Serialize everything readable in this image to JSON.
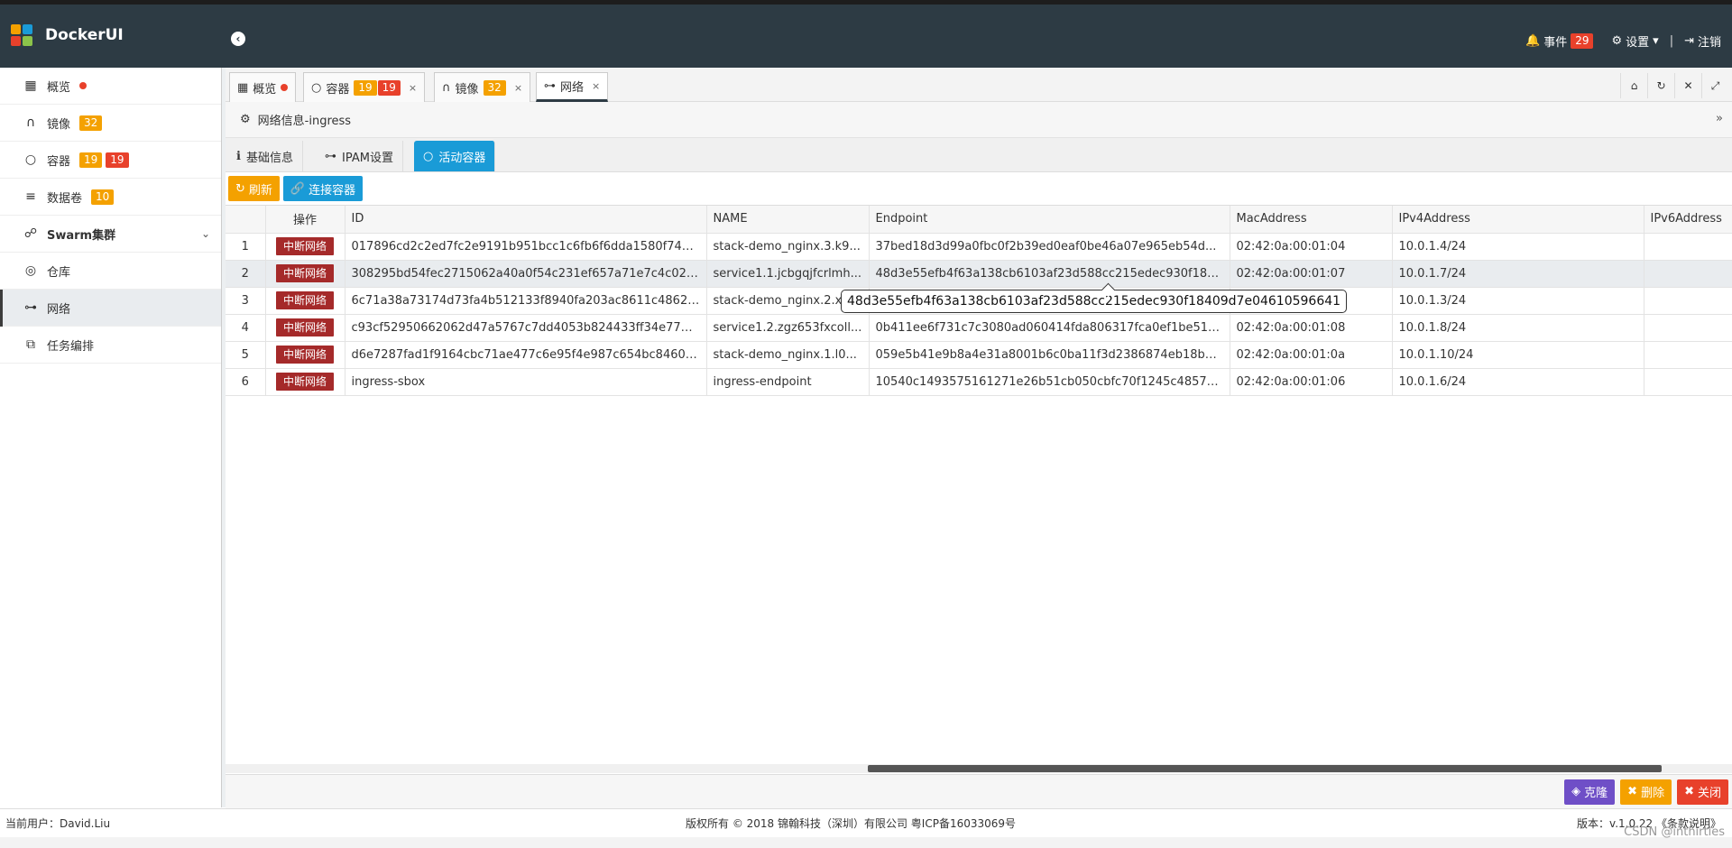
{
  "header": {
    "brand": "DockerUI",
    "events_label": "事件",
    "events_count": "29",
    "settings_label": "设置",
    "logout_label": "注销"
  },
  "sidebar": {
    "items": [
      {
        "label": "概览",
        "icon": "windows-icon"
      },
      {
        "label": "镜像",
        "icon": "headphones-icon",
        "badge": "32"
      },
      {
        "label": "容器",
        "icon": "ring-icon",
        "badge1": "19",
        "badge2": "19"
      },
      {
        "label": "数据卷",
        "icon": "database-icon",
        "badge": "10"
      },
      {
        "label": "Swarm集群",
        "icon": "sitemap-icon"
      },
      {
        "label": "仓库",
        "icon": "podcast-icon"
      },
      {
        "label": "网络",
        "icon": "usb-icon"
      },
      {
        "label": "任务编排",
        "icon": "puzzle-icon"
      }
    ]
  },
  "tabs": {
    "overview": "概览",
    "containers": "容器",
    "containers_b1": "19",
    "containers_b2": "19",
    "images": "镜像",
    "images_b": "32",
    "network": "网络",
    "close": "×"
  },
  "panel": {
    "title": "网络信息-ingress"
  },
  "subtabs": {
    "basic": "基础信息",
    "ipam": "IPAM设置",
    "active": "活动容器"
  },
  "toolbar": {
    "refresh": "刷新",
    "connect": "连接容器"
  },
  "table": {
    "headers": [
      "操作",
      "ID",
      "NAME",
      "Endpoint",
      "MacAddress",
      "IPv4Address",
      "IPv6Address"
    ],
    "action_label": "中断网络",
    "rows": [
      {
        "n": "1",
        "id": "017896cd2c2ed7fc2e9191b951bcc1c6fb6f6dda1580f741...",
        "name": "stack-demo_nginx.3.k9...",
        "endpoint": "37bed18d3d99a0fbc0f2b39ed0eaf0be46a07e965eb54d...",
        "mac": "02:42:0a:00:01:04",
        "ipv4": "10.0.1.4/24",
        "ipv6": ""
      },
      {
        "n": "2",
        "id": "308295bd54fec2715062a40a0f54c231ef657a71e7c4c028...",
        "name": "service1.1.jcbgqjfcrlmh...",
        "endpoint": "48d3e55efb4f63a138cb6103af23d588cc215edec930f184...",
        "mac": "02:42:0a:00:01:07",
        "ipv4": "10.0.1.7/24",
        "ipv6": ""
      },
      {
        "n": "3",
        "id": "6c71a38a73174d73fa4b512133f8940fa203ac8611c4862e...",
        "name": "stack-demo_nginx.2.x",
        "endpoint": "",
        "mac": "",
        "ipv4": "10.0.1.3/24",
        "ipv6": ""
      },
      {
        "n": "4",
        "id": "c93cf52950662062d47a5767c7dd4053b824433ff34e771c...",
        "name": "service1.2.zgz653fxcoll...",
        "endpoint": "0b411ee6f731c7c3080ad060414fda806317fca0ef1be51d...",
        "mac": "02:42:0a:00:01:08",
        "ipv4": "10.0.1.8/24",
        "ipv6": ""
      },
      {
        "n": "5",
        "id": "d6e7287fad1f9164cbc71ae477c6e95f4e987c654bc8460f...",
        "name": "stack-demo_nginx.1.l0...",
        "endpoint": "059e5b41e9b8a4e31a8001b6c0ba11f3d2386874eb18b8...",
        "mac": "02:42:0a:00:01:0a",
        "ipv4": "10.0.1.10/24",
        "ipv6": ""
      },
      {
        "n": "6",
        "id": "ingress-sbox",
        "name": "ingress-endpoint",
        "endpoint": "10540c1493575161271e26b51cb050cbfc70f1245c48577...",
        "mac": "02:42:0a:00:01:06",
        "ipv4": "10.0.1.6/24",
        "ipv6": ""
      }
    ]
  },
  "tooltip": "48d3e55efb4f63a138cb6103af23d588cc215edec930f18409d7e04610596641",
  "footer": {
    "clone": "克隆",
    "delete": "删除",
    "close": "关闭"
  },
  "status": {
    "user": "当前用户：David.Liu",
    "copyright": "版权所有 © 2018 锦翰科技（深圳）有限公司 粤ICP备16033069号",
    "version": "版本：v.1.0.22 《条款说明》"
  },
  "watermark": "CSDN @inthirties",
  "colors": {
    "header_bg": "#2d3b44",
    "accent_blue": "#1a9bd7",
    "accent_orange": "#f4a100",
    "accent_red": "#e8412b",
    "danger_dark": "#a52a2a"
  }
}
